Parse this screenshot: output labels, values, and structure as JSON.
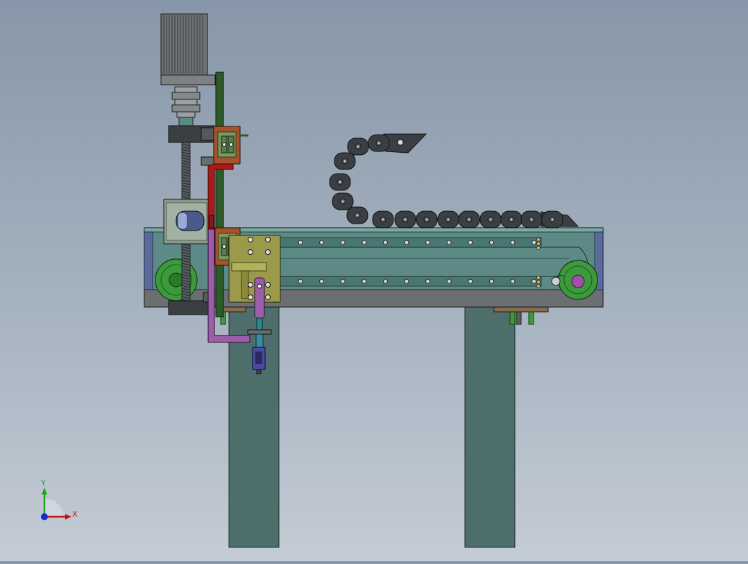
{
  "viewport": {
    "background_top": "#8797a9",
    "background_bottom": "#c4ccd5"
  },
  "triad": {
    "x_label": "X",
    "y_label": "Y",
    "x_color": "#c0141c",
    "y_color": "#1aa31a",
    "z_color": "#1a2ccc"
  },
  "colors": {
    "frame_teal": "#5d8a86",
    "leg_teal": "#4e6e6c",
    "chain_dark": "#3b3f44",
    "motor_gray": "#6e7175",
    "bracket_red": "#b01818",
    "bracket_purple": "#9b5ea8",
    "rail_green": "#2e5a2a",
    "plate_olive": "#9a9a4a",
    "block_orange": "#a4542c",
    "pulley_green": "#3c9a3c"
  }
}
